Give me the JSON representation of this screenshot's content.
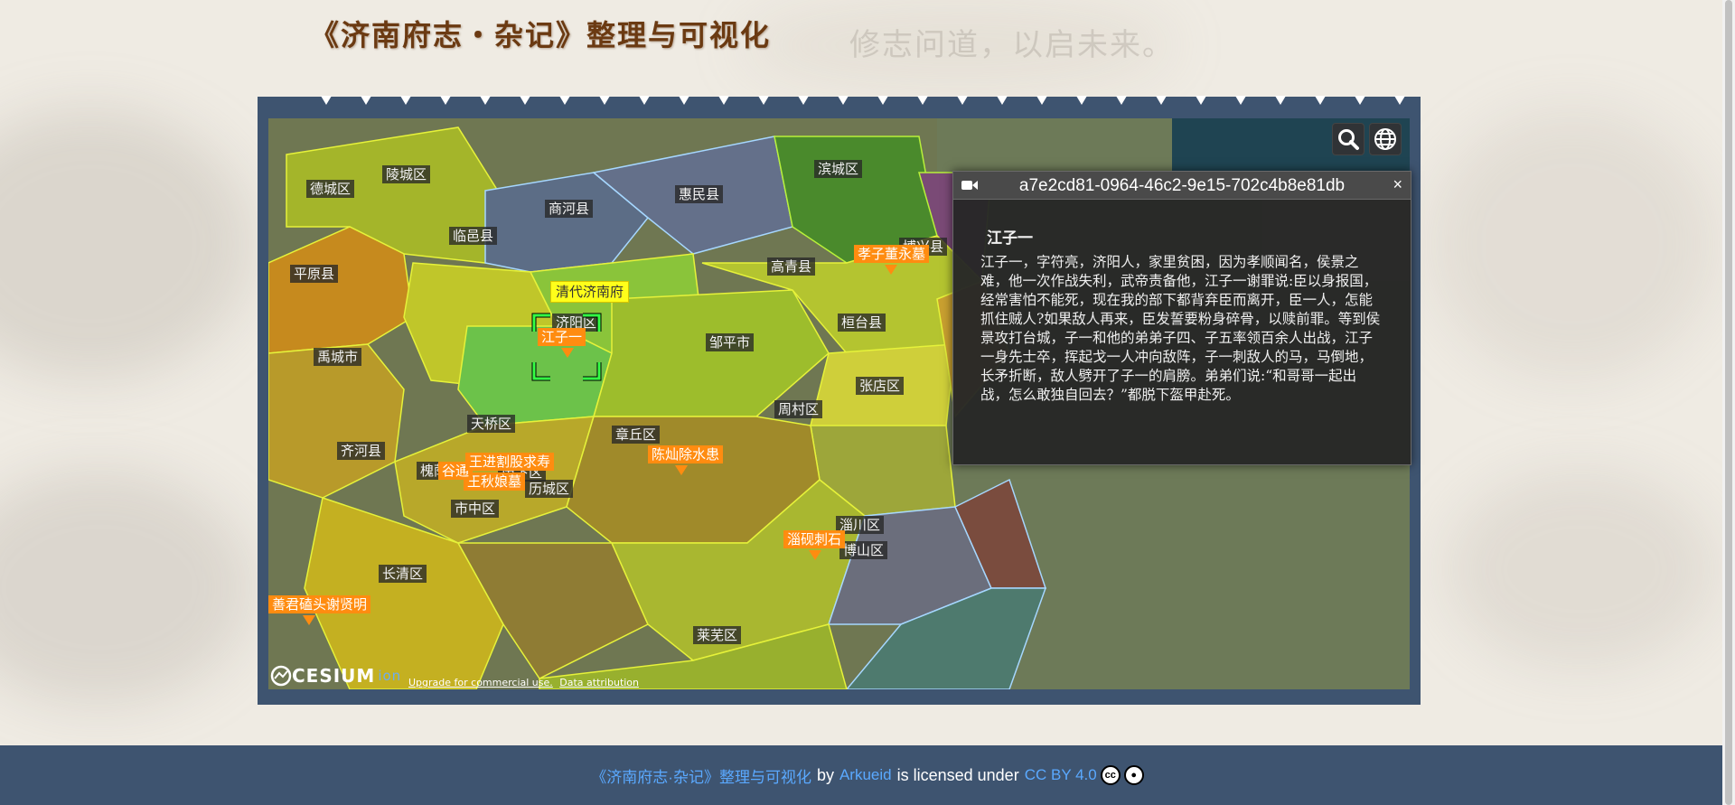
{
  "header": {
    "title": "《济南府志・杂记》整理与可视化",
    "motto": "修志问道，以启未来。"
  },
  "map": {
    "highlight_label": "清代济南府",
    "selected_label": "江子一",
    "regions": [
      "德城区",
      "陵城区",
      "商河县",
      "惠民县",
      "滨城区",
      "临邑县",
      "平原县",
      "高青县",
      "邹平市",
      "桓台县",
      "禹城市",
      "济阳区",
      "天桥区",
      "章丘区",
      "周村区",
      "张店区",
      "齐河县",
      "历城区",
      "市中区",
      "淄川区",
      "博山区",
      "长清区",
      "莱芜区",
      "博兴县",
      "槐荫区",
      "历下区"
    ],
    "pois": [
      "孝子董永墓",
      "江子一",
      "陈灿除水患",
      "王秋娘墓",
      "谷通",
      "王进割股求寿",
      "淄砚刺石",
      "善君磕头谢贤明"
    ],
    "controls": {
      "search": "search-icon",
      "scene_mode": "globe-icon"
    },
    "logo": {
      "brand": "CESIUM",
      "suffix": "ion"
    },
    "credits": [
      "Upgrade for commercial use.",
      "Data attribution"
    ]
  },
  "infobox": {
    "title": "a7e2cd81-0964-46c2-9e15-702c4b8e81db",
    "close": "×",
    "entry_title": "江子一",
    "entry_text": "江子一，字符亮，济阳人，家里贫困，因为孝顺闻名，侯景之难，他一次作战失利，武帝责备他，江子一谢罪说:臣以身报国，经常害怕不能死，现在我的部下都背弃臣而离开，臣一人，怎能抓住贼人?如果敌人再来，臣发誓要粉身碎骨，以赎前罪。等到侯景攻打台城，子一和他的弟弟子四、子五率领百余人出战，江子一身先士卒，挥起戈一人冲向敌阵，子一刺敌人的马，马倒地，长矛折断，敌人劈开了子一的肩膀。弟弟们说:“和哥哥一起出战，怎么敢独自回去？”都脱下盔甲赴死。"
  },
  "footer": {
    "work": "《济南府志·杂记》整理与可视化",
    "by": "by",
    "author": "Arkueid",
    "licensed": "is licensed under",
    "license": "CC BY 4.0"
  },
  "colors": {
    "frame": "#3e5470",
    "title": "#6b3a12",
    "poi": "#ff8c10",
    "highlight": "#ffff1a",
    "link": "#5aa9ff"
  }
}
